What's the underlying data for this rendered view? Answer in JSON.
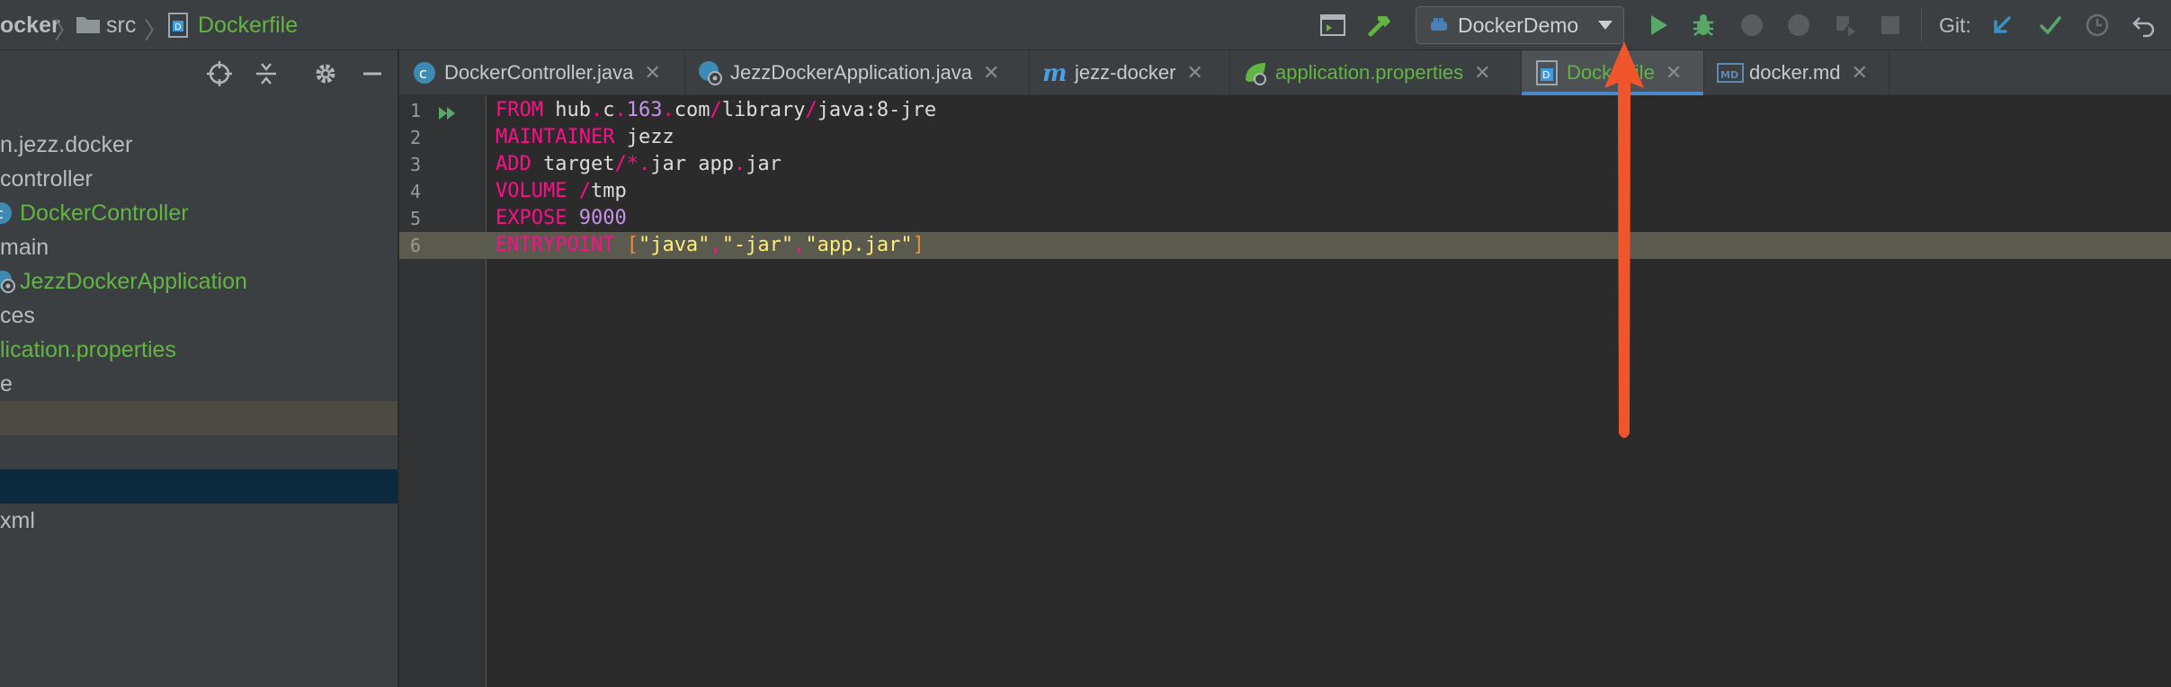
{
  "breadcrumbs": [
    "ocker",
    "src",
    "Dockerfile"
  ],
  "run_config": {
    "name": "DockerDemo"
  },
  "git_label": "Git:",
  "tabs": [
    {
      "label": "DockerController.java",
      "icon": "class-c-icon"
    },
    {
      "label": "JezzDockerApplication.java",
      "icon": "spring-boot-class-icon"
    },
    {
      "label": "jezz-docker",
      "icon": "maven-m-icon"
    },
    {
      "label": "application.properties",
      "icon": "spring-leaf-icon"
    },
    {
      "label": "Dockerfile",
      "icon": "dockerfile-icon",
      "active": true
    },
    {
      "label": "docker.md",
      "icon": "markdown-icon"
    }
  ],
  "project_tree": [
    {
      "label": "n.jezz.docker"
    },
    {
      "label": "controller"
    },
    {
      "label": "DockerController",
      "icon": "class-c-icon"
    },
    {
      "label": "main"
    },
    {
      "label": "JezzDockerApplication",
      "icon": "spring-boot-class-icon"
    },
    {
      "label": "ces"
    },
    {
      "label": "lication.properties"
    },
    {
      "label": "e"
    },
    {
      "label": ""
    },
    {
      "label": ""
    },
    {
      "label": ""
    },
    {
      "label": "xml"
    }
  ],
  "editor": {
    "line_numbers": [
      "1",
      "2",
      "3",
      "4",
      "5",
      "6"
    ],
    "lines": [
      "FROM hub.c.163.com/library/java:8-jre",
      "MAINTAINER jezz",
      "ADD target/*.jar app.jar",
      "VOLUME /tmp",
      "EXPOSE 9000",
      "ENTRYPOINT [\"java\",\"-jar\",\"app.jar\"]"
    ],
    "current_line": 6
  },
  "colors": {
    "accent_green": "#62b543",
    "keyword": "#ff0d8a",
    "string": "#ffee7a",
    "number": "#c792ea",
    "annotation_arrow": "#f0552b",
    "active_tab_underline": "#4a88c7"
  }
}
